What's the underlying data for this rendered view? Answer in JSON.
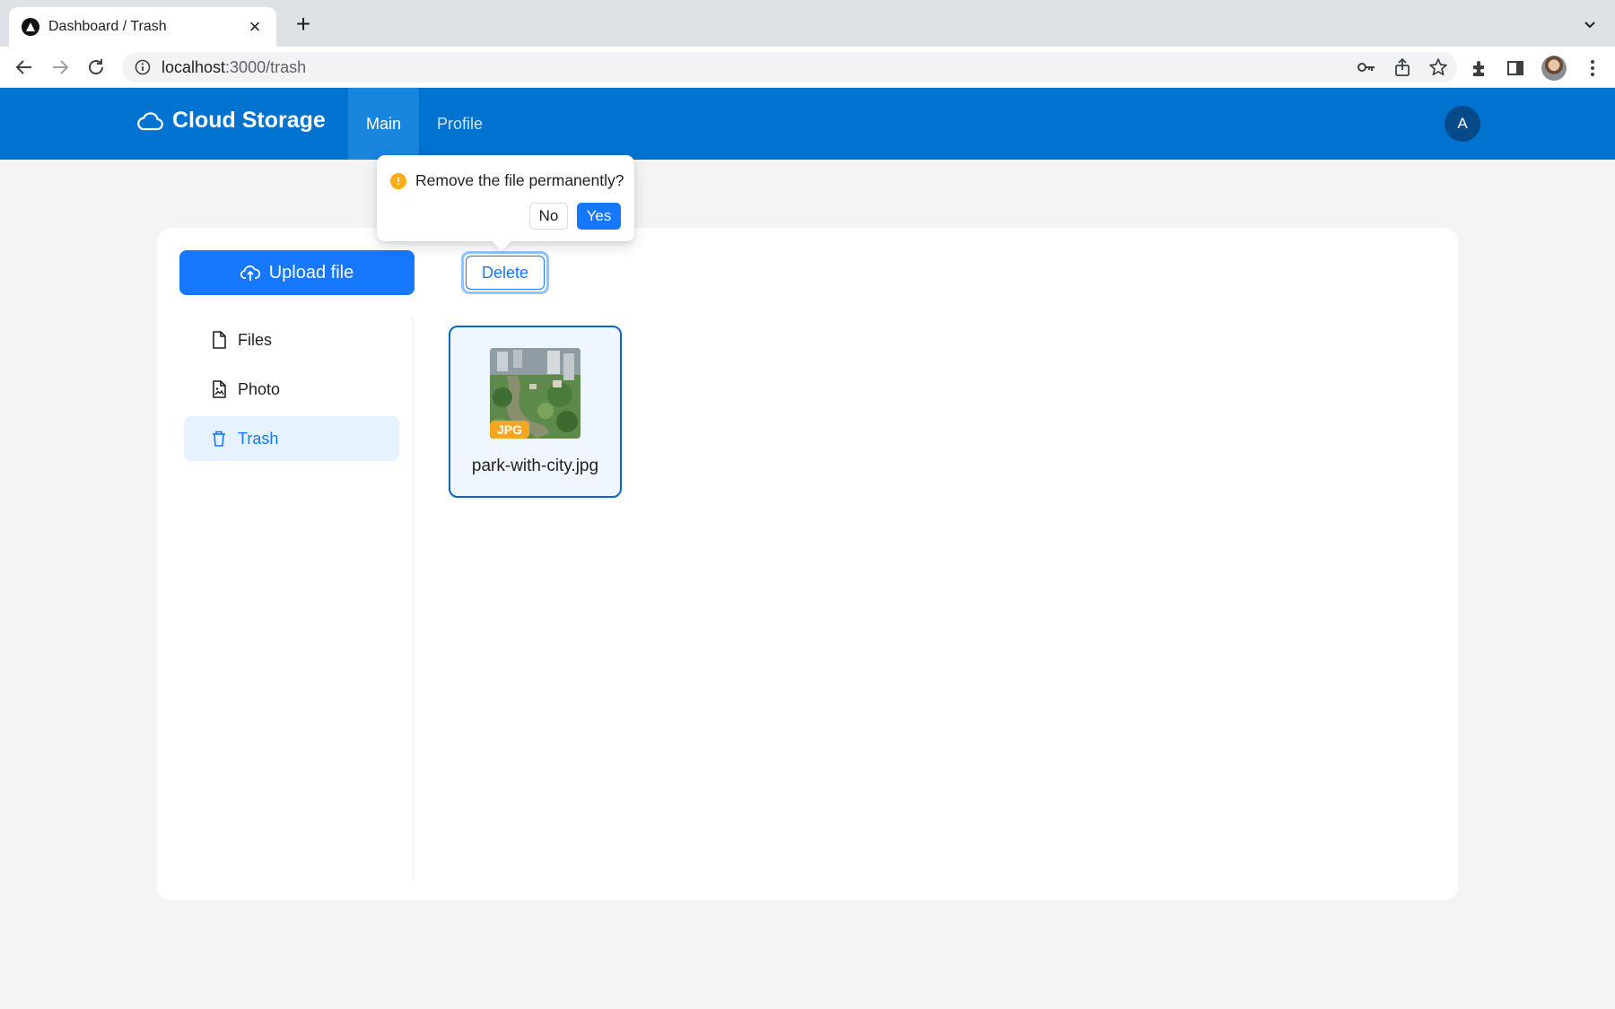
{
  "browser": {
    "tab_title": "Dashboard / Trash",
    "url_host": "localhost",
    "url_path": ":3000/trash"
  },
  "app": {
    "brand": "Cloud Storage",
    "nav": [
      {
        "label": "Main",
        "active": true
      },
      {
        "label": "Profile",
        "active": false
      }
    ],
    "avatar_initial": "A"
  },
  "actions": {
    "upload_label": "Upload file",
    "delete_label": "Delete"
  },
  "sidebar": {
    "items": [
      {
        "label": "Files",
        "icon": "file-icon",
        "active": false
      },
      {
        "label": "Photo",
        "icon": "photo-file-icon",
        "active": false
      },
      {
        "label": "Trash",
        "icon": "trash-icon",
        "active": true
      }
    ]
  },
  "files": [
    {
      "name": "park-with-city.jpg",
      "ext": "JPG",
      "selected": true
    }
  ],
  "popconfirm": {
    "message": "Remove the file permanently?",
    "no_label": "No",
    "yes_label": "Yes"
  },
  "colors": {
    "header": "#0072d0",
    "primary": "#1677ff",
    "badge": "#f5a623",
    "warning": "#faad14"
  }
}
